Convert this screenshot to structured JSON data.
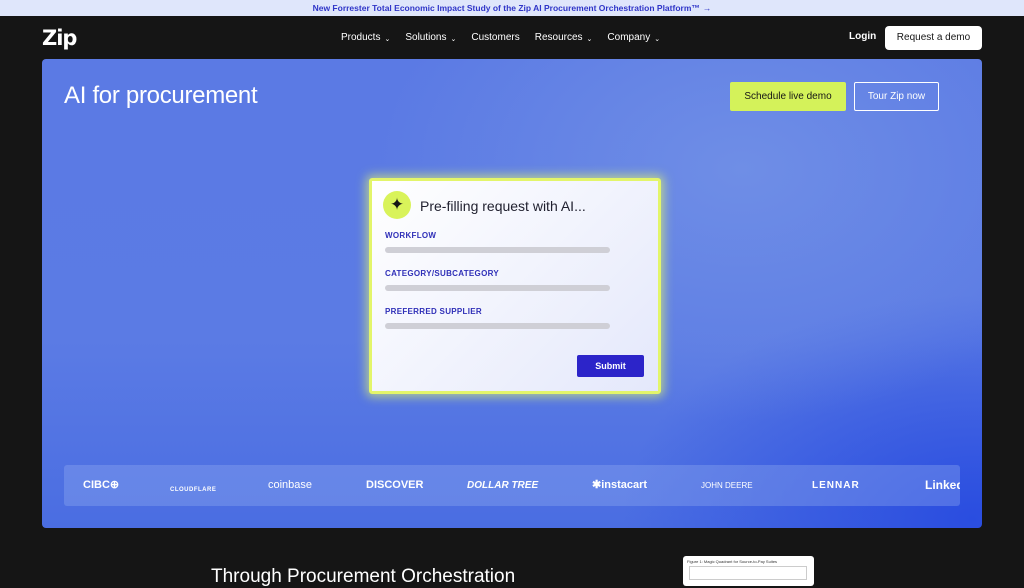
{
  "announcement": {
    "text": "New Forrester Total Economic Impact Study of the Zip AI Procurement Orchestration Platform™",
    "arrow": "→"
  },
  "nav": {
    "logo": "Zip",
    "items": [
      {
        "label": "Products",
        "dropdown": true
      },
      {
        "label": "Solutions",
        "dropdown": true
      },
      {
        "label": "Customers",
        "dropdown": false
      },
      {
        "label": "Resources",
        "dropdown": true
      },
      {
        "label": "Company",
        "dropdown": true
      }
    ],
    "login": "Login",
    "request_demo": "Request a demo"
  },
  "hero": {
    "title": "AI for procurement",
    "schedule_demo": "Schedule live demo",
    "tour": "Tour Zip now",
    "card": {
      "icon": "sparkle-icon",
      "title": "Pre-filling request with AI...",
      "fields": [
        "WORKFLOW",
        "CATEGORY/SUBCATEGORY",
        "PREFERRED SUPPLIER"
      ],
      "submit": "Submit"
    },
    "customer_logos": [
      "CIBC⊕",
      "CLOUDFLARE",
      "coinbase",
      "DISCOVER",
      "DOLLAR TREE",
      "✱instacart",
      "JOHN DEERE",
      "LENNAR",
      "Linked"
    ]
  },
  "below": {
    "heading": "Through Procurement Orchestration",
    "report_caption": "Figure 1: Magic Quadrant for Source-to-Pay Suites"
  },
  "colors": {
    "accent": "#d4f25a",
    "primary": "#2c24c9",
    "hero": "#5b7ae4"
  }
}
